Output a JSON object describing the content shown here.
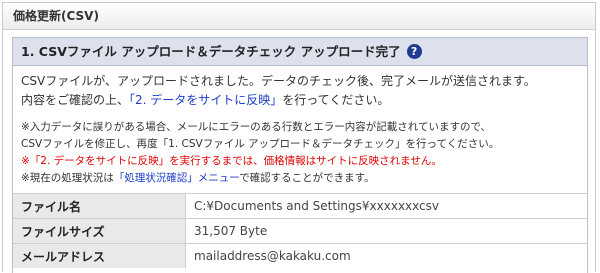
{
  "panel": {
    "title": "価格更新(CSV)"
  },
  "step": {
    "title": "1. CSVファイル アップロード＆データチェック アップロード完了"
  },
  "message": {
    "line1": "CSVファイルが、アップロードされました。データのチェック後、完了メールが送信されます。",
    "line2_prefix": "内容をご確認の上、",
    "line2_link": "「2. データをサイトに反映」",
    "line2_suffix": "を行ってください。"
  },
  "notes": {
    "line1": "※入力データに誤りがある場合、メールにエラーのある行数とエラー内容が記載されていますので、",
    "line2": "CSVファイルを修正し、再度「1. CSVファイル アップロード＆データチェック」を行ってください。",
    "line3": "※「2. データをサイトに反映」を実行するまでは、価格情報はサイトに反映されません。",
    "line4_prefix": "※現在の処理状況は",
    "line4_link": "「処理状況確認」メニュー",
    "line4_suffix": "で確認することができます。"
  },
  "info_rows": [
    {
      "label": "ファイル名",
      "value": "C:¥Documents and Settings¥xxxxxxxcsv"
    },
    {
      "label": "ファイルサイズ",
      "value": "31,507 Byte"
    },
    {
      "label": "メールアドレス",
      "value": "mailaddress@kakaku.com"
    }
  ]
}
